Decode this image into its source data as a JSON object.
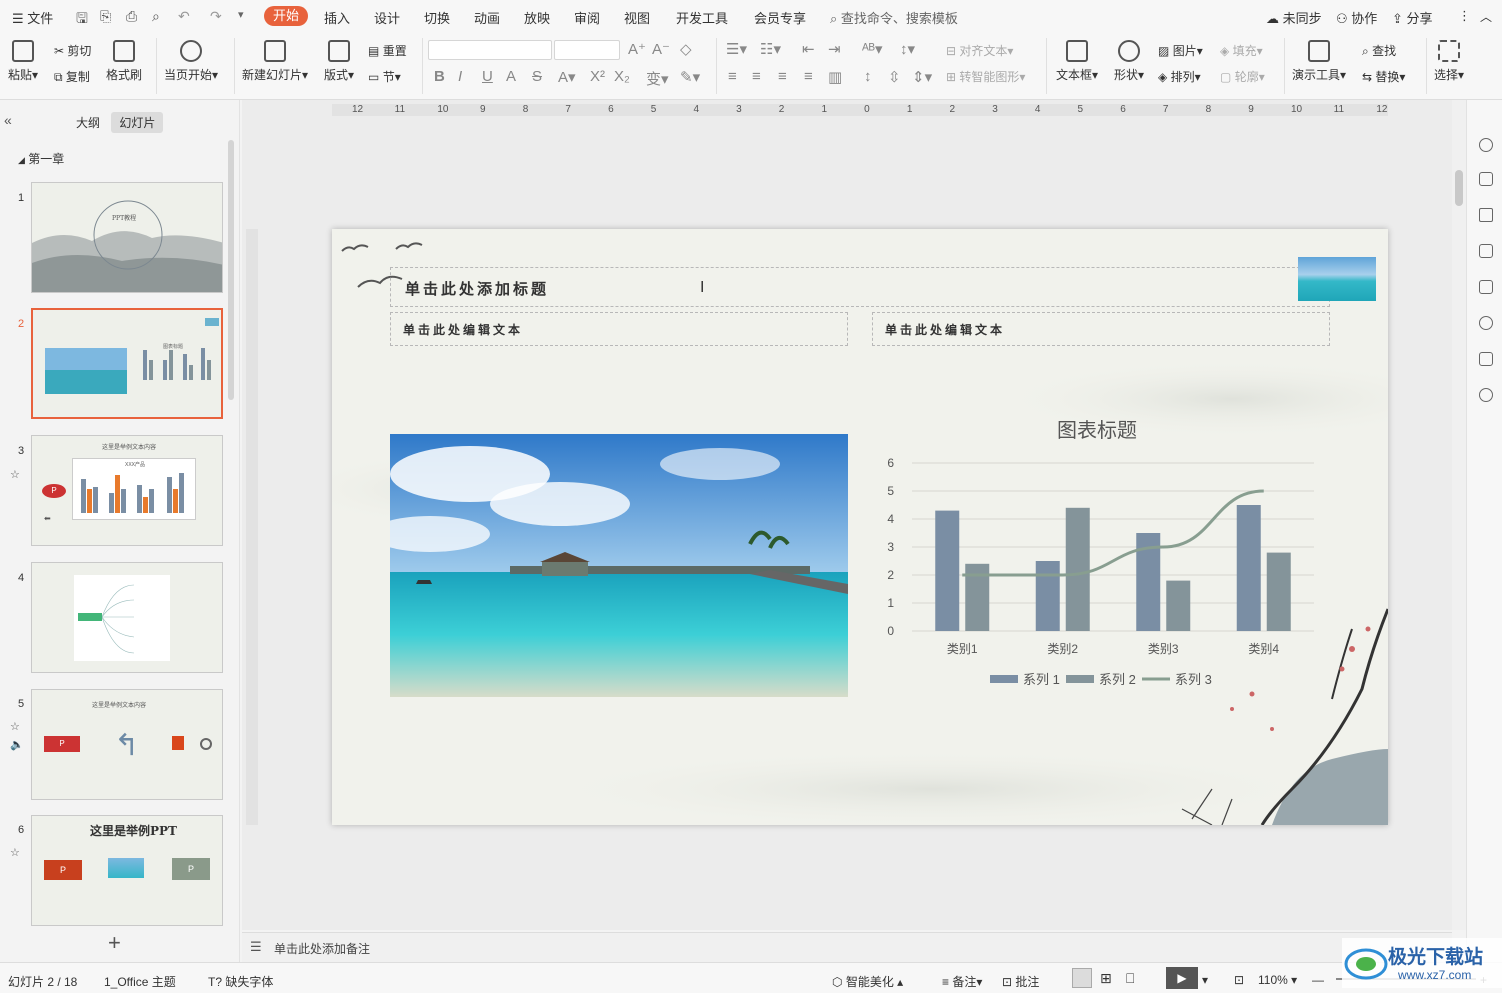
{
  "menubar": {
    "file": "文件",
    "tabs": [
      "开始",
      "插入",
      "设计",
      "切换",
      "动画",
      "放映",
      "审阅",
      "视图",
      "开发工具",
      "会员专享"
    ],
    "search": "查找命令、搜索模板",
    "unsync": "未同步",
    "collab": "协作",
    "share": "分享"
  },
  "ribbon": {
    "paste": "粘贴",
    "cut": "剪切",
    "copy": "复制",
    "format_painter": "格式刷",
    "from_start": "当页开始",
    "new_slide": "新建幻灯片",
    "layout": "版式",
    "reset": "重置",
    "section": "节",
    "align_text": "对齐文本",
    "smart_shape": "转智能图形",
    "textbox": "文本框",
    "shape": "形状",
    "picture": "图片",
    "fill": "填充",
    "arrange": "排列",
    "outline": "轮廓",
    "present_tools": "演示工具",
    "find": "查找",
    "replace": "替换",
    "select": "选择"
  },
  "panel": {
    "tab_outline": "大纲",
    "tab_slides": "幻灯片",
    "chapter": "第一章",
    "slide_numbers": [
      "1",
      "2",
      "3",
      "4",
      "5",
      "6"
    ],
    "thumb1_title": "PPT教程",
    "thumb2_chart_title": "图表标题",
    "thumb3_title": "这里是举例文本内容",
    "thumb3_chart_title": "XXX产品",
    "thumb5_title": "这里是举例文本内容",
    "thumb6_title": "这里是举例PPT"
  },
  "slide": {
    "title_placeholder": "单击此处添加标题",
    "text_left": "单击此处编辑文本",
    "text_right": "单击此处编辑文本"
  },
  "chart_data": {
    "type": "bar",
    "title": "图表标题",
    "categories": [
      "类别1",
      "类别2",
      "类别3",
      "类别4"
    ],
    "series": [
      {
        "name": "系列 1",
        "values": [
          4.3,
          2.5,
          3.5,
          4.5
        ],
        "color": "#7a8ea4"
      },
      {
        "name": "系列 2",
        "values": [
          2.4,
          4.4,
          1.8,
          2.8
        ],
        "color": "#84949a"
      },
      {
        "name": "系列 3",
        "type": "line",
        "values": [
          2,
          2,
          3,
          5
        ],
        "color": "#889e90"
      }
    ],
    "ylim": [
      0,
      6
    ],
    "yticks": [
      "0",
      "1",
      "2",
      "3",
      "4",
      "5",
      "6"
    ],
    "grid": true,
    "legend": "bottom"
  },
  "ruler": {
    "ticks": [
      "12",
      "11",
      "10",
      "9",
      "8",
      "7",
      "6",
      "5",
      "4",
      "3",
      "2",
      "1",
      "0",
      "1",
      "2",
      "3",
      "4",
      "5",
      "6",
      "7",
      "8",
      "9",
      "10",
      "11",
      "12"
    ]
  },
  "notes": "单击此处添加备注",
  "status": {
    "slide_pos": "幻灯片 2 / 18",
    "theme": "1_Office 主题",
    "missing_font": "缺失字体",
    "beautify": "智能美化",
    "notes_btn": "备注",
    "comment": "批注",
    "zoom": "110%"
  },
  "watermark": "极光下载站",
  "watermark_url": "www.xz7.com"
}
